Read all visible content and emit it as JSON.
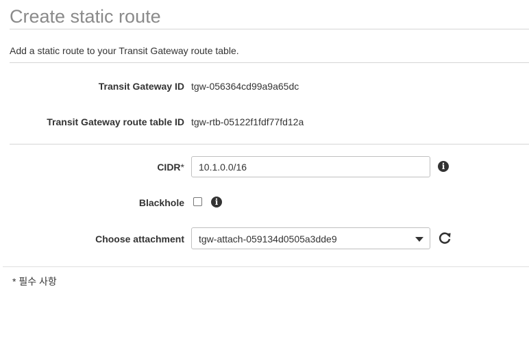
{
  "page": {
    "title": "Create static route",
    "description": "Add a static route to your Transit Gateway route table.",
    "required_note": "* 필수 사항"
  },
  "info": {
    "tgw_id": {
      "label": "Transit Gateway ID",
      "value": "tgw-056364cd99a9a65dc"
    },
    "route_table_id": {
      "label": "Transit Gateway route table ID",
      "value": "tgw-rtb-05122f1fdf77fd12a"
    }
  },
  "form": {
    "cidr": {
      "label": "CIDR",
      "required_mark": "*",
      "value": "10.1.0.0/16",
      "info_icon": "info-icon"
    },
    "blackhole": {
      "label": "Blackhole",
      "checked": false,
      "info_icon": "info-icon"
    },
    "attachment": {
      "label": "Choose attachment",
      "selected": "tgw-attach-059134d0505a3dde9",
      "caret_icon": "caret-down-icon",
      "refresh_icon": "refresh-icon"
    }
  },
  "colors": {
    "title": "#8a8a8a",
    "text": "#333333",
    "border": "#bfbfbf",
    "divider": "#d5d5d5"
  }
}
